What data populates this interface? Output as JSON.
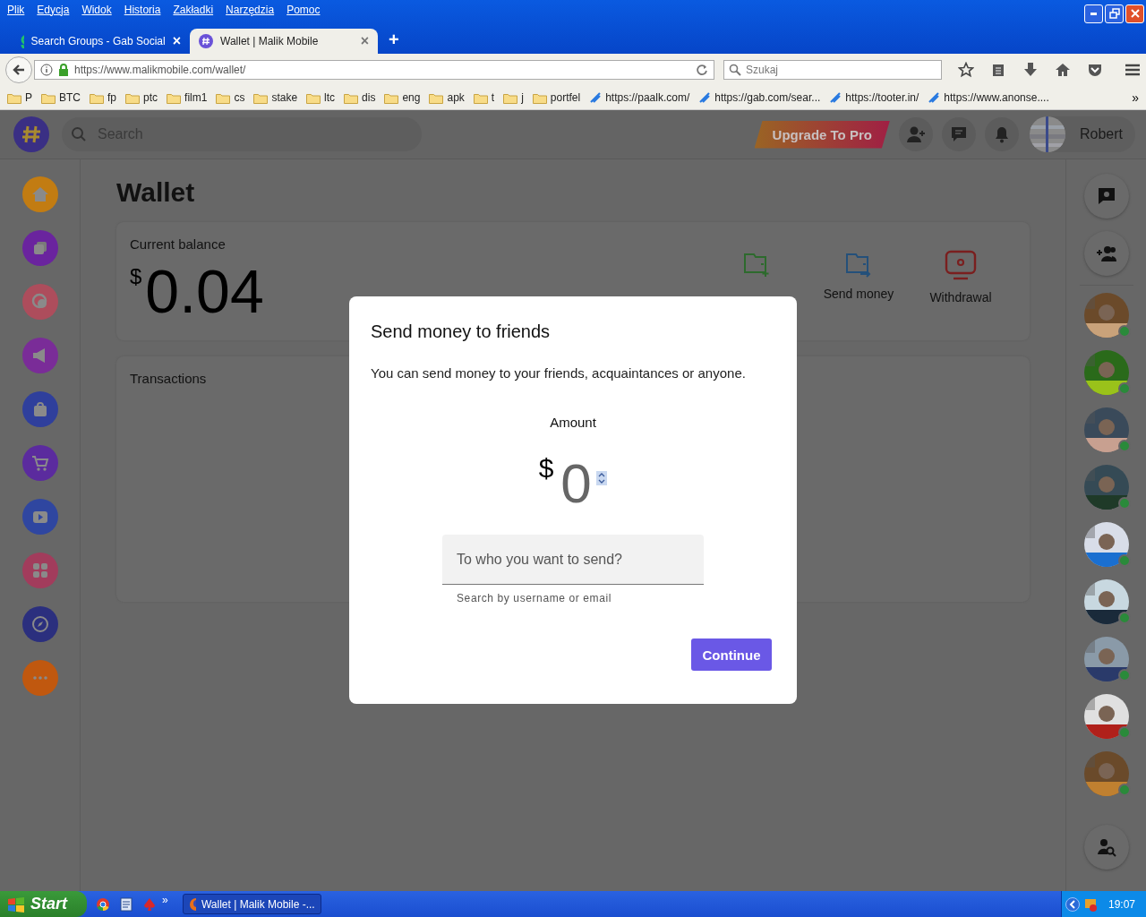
{
  "browser": {
    "menu": [
      "Plik",
      "Edycja",
      "Widok",
      "Historia",
      "Zakładki",
      "Narzędzia",
      "Pomoc"
    ],
    "tabs": [
      {
        "title": "Search Groups - Gab Social",
        "selected": false,
        "close": "×"
      },
      {
        "title": "Wallet | Malik Mobile",
        "selected": true,
        "close": "×"
      }
    ],
    "new_tab": "+",
    "url": "https://www.malikmobile.com/wallet/",
    "search_placeholder": "Szukaj",
    "bookmarks": [
      {
        "label": "P",
        "kind": "folder"
      },
      {
        "label": "BTC",
        "kind": "folder"
      },
      {
        "label": "fp",
        "kind": "folder"
      },
      {
        "label": "ptc",
        "kind": "folder"
      },
      {
        "label": "film1",
        "kind": "folder"
      },
      {
        "label": "cs",
        "kind": "folder"
      },
      {
        "label": "stake",
        "kind": "folder"
      },
      {
        "label": "ltc",
        "kind": "folder"
      },
      {
        "label": "dis",
        "kind": "folder"
      },
      {
        "label": "eng",
        "kind": "folder"
      },
      {
        "label": "apk",
        "kind": "folder"
      },
      {
        "label": "t",
        "kind": "folder"
      },
      {
        "label": "j",
        "kind": "folder"
      },
      {
        "label": "portfel",
        "kind": "folder"
      },
      {
        "label": "https://paalk.com/",
        "kind": "link"
      },
      {
        "label": "https://gab.com/sear...",
        "kind": "link"
      },
      {
        "label": "https://tooter.in/",
        "kind": "link"
      },
      {
        "label": "https://www.anonse....",
        "kind": "link"
      }
    ],
    "overflow": "»"
  },
  "app": {
    "search_placeholder": "Search",
    "upgrade": "Upgrade To Pro",
    "user": "Robert",
    "nav": [
      {
        "color": "#c27c12"
      },
      {
        "color": "#6a249e"
      },
      {
        "color": "#ad4d5c"
      },
      {
        "color": "#7a2c98"
      },
      {
        "color": "#2f3f9c"
      },
      {
        "color": "#5b2b9e"
      },
      {
        "color": "#2f46a0"
      },
      {
        "color": "#a23c5c"
      },
      {
        "color": "#2b2f7e"
      },
      {
        "color": "#c0580f"
      }
    ],
    "page_title": "Wallet",
    "balance_label": "Current balance",
    "currency": "$",
    "balance": "0.04",
    "actions": [
      {
        "kind": "deposit"
      },
      {
        "kind": "send",
        "label": "Send money"
      },
      {
        "kind": "withdraw",
        "label": "Withdrawal"
      }
    ],
    "transactions_title": "Transactions",
    "contacts": [
      {
        "kind": "picture",
        "online": true
      },
      {
        "kind": "picture",
        "online": true
      },
      {
        "kind": "picture",
        "online": true
      },
      {
        "kind": "picture",
        "online": true
      },
      {
        "kind": "picture",
        "online": true
      },
      {
        "kind": "picture",
        "online": true
      },
      {
        "kind": "picture",
        "online": true
      },
      {
        "kind": "picture",
        "online": true
      },
      {
        "kind": "picture",
        "online": true
      }
    ]
  },
  "modal": {
    "title": "Send money to friends",
    "text": "You can send money to your friends, acquaintances or anyone.",
    "amount_label": "Amount",
    "currency": "$",
    "amount": "0",
    "recipient_placeholder": "To who you want to send?",
    "helper": "Search by username or email",
    "button": "Continue"
  },
  "taskbar": {
    "start": "Start",
    "quick_overflow": "»",
    "window": "Wallet | Malik Mobile -...",
    "clock": "19:07"
  }
}
